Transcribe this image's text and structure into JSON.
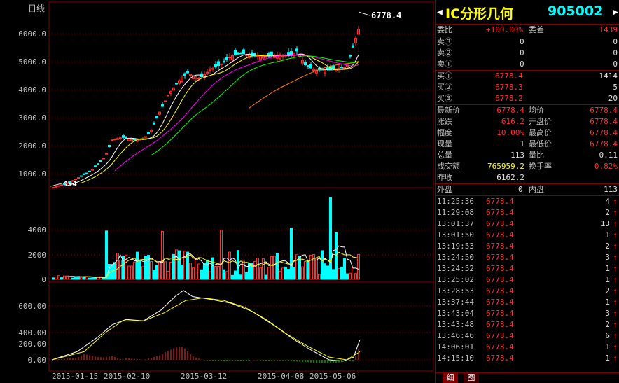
{
  "chart": {
    "period_label": "日线",
    "high_label": "6778.4",
    "low_label": "494",
    "price_ticks": [
      "6000.0",
      "5000.0",
      "4000.0",
      "3000.0",
      "2000.0",
      "1000.0"
    ],
    "volume_ticks": [
      "4000",
      "2000",
      "0"
    ],
    "macd_ticks": [
      "600.00",
      "400.00",
      "200.00",
      "0.00"
    ],
    "date_labels": [
      "2015-01-15",
      "2015-02-10",
      "2015-03-12",
      "2015-04-08",
      "2015-05-06"
    ]
  },
  "chart_data": {
    "type": "candlestick",
    "price_axis": [
      1000,
      6000
    ],
    "volume_axis": [
      0,
      4000
    ],
    "macd_axis": [
      0,
      600
    ],
    "highest_price": 6778.4,
    "lowest_price": 494
  },
  "header": {
    "name": "IC分形几何",
    "code": "905002",
    "arrow_left": "◀",
    "arrow_right": "▶"
  },
  "weibi": {
    "label": "委比",
    "value": "+100.00%",
    "diff_label": "委差",
    "diff_value": "1439"
  },
  "sell": [
    {
      "label": "卖③",
      "price": "0",
      "vol": "0"
    },
    {
      "label": "卖②",
      "price": "0",
      "vol": "0"
    },
    {
      "label": "卖①",
      "price": "0",
      "vol": "0"
    }
  ],
  "buy": [
    {
      "label": "买①",
      "price": "6778.4",
      "vol": "1414"
    },
    {
      "label": "买②",
      "price": "6778.3",
      "vol": "5"
    },
    {
      "label": "买③",
      "price": "6778.2",
      "vol": "20"
    }
  ],
  "stats": [
    {
      "l1": "最新价",
      "v1": "6778.4",
      "l2": "均价",
      "v2": "6778.4"
    },
    {
      "l1": "涨跌",
      "v1": "616.2",
      "l2": "开盘价",
      "v2": "6778.4"
    },
    {
      "l1": "幅度",
      "v1": "10.00%",
      "l2": "最高价",
      "v2": "6778.4"
    },
    {
      "l1": "现量",
      "v1": "1",
      "l2": "最低价",
      "v2": "6778.4"
    },
    {
      "l1": "总量",
      "v1": "113",
      "l2": "量比",
      "v2": "0.11"
    },
    {
      "l1": "成交额",
      "v1": "765959.2",
      "l2": "换手率",
      "v2": "0.82%"
    },
    {
      "l1": "昨收",
      "v1": "6162.2",
      "l2": "",
      "v2": ""
    }
  ],
  "outer": {
    "l1": "外盘",
    "v1": "0",
    "l2": "内盘",
    "v2": "113"
  },
  "ticks": [
    {
      "time": "11:25:36",
      "price": "6778.4",
      "vol": "4",
      "dir": "↑"
    },
    {
      "time": "11:29:08",
      "price": "6778.4",
      "vol": "2",
      "dir": "↑"
    },
    {
      "time": "13:01:37",
      "price": "6778.4",
      "vol": "13",
      "dir": "↑"
    },
    {
      "time": "13:01:50",
      "price": "6778.4",
      "vol": "1",
      "dir": "↑"
    },
    {
      "time": "13:19:53",
      "price": "6778.4",
      "vol": "2",
      "dir": "↑"
    },
    {
      "time": "13:24:50",
      "price": "6778.4",
      "vol": "3",
      "dir": "↑"
    },
    {
      "time": "13:24:52",
      "price": "6778.4",
      "vol": "1",
      "dir": "↑"
    },
    {
      "time": "13:25:02",
      "price": "6778.4",
      "vol": "1",
      "dir": "↑"
    },
    {
      "time": "13:28:53",
      "price": "6778.4",
      "vol": "2",
      "dir": "↑"
    },
    {
      "time": "13:37:44",
      "price": "6778.4",
      "vol": "1",
      "dir": "↑"
    },
    {
      "time": "13:43:04",
      "price": "6778.4",
      "vol": "3",
      "dir": "↑"
    },
    {
      "time": "13:43:48",
      "price": "6778.4",
      "vol": "2",
      "dir": "↑"
    },
    {
      "time": "13:46:46",
      "price": "6778.4",
      "vol": "6",
      "dir": "↑"
    },
    {
      "time": "14:06:01",
      "price": "6778.4",
      "vol": "1",
      "dir": "↑"
    },
    {
      "time": "14:15:10",
      "price": "6778.4",
      "vol": "1",
      "dir": "↑"
    }
  ],
  "tabs": [
    {
      "label": "细"
    },
    {
      "label": "图"
    }
  ]
}
